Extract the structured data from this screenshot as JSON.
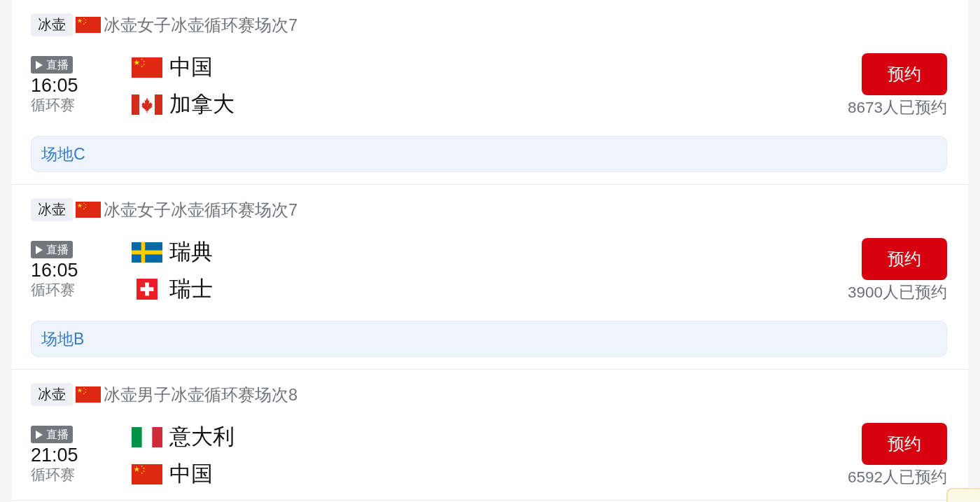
{
  "matches": [
    {
      "sport_tag": "冰壶",
      "event_flag": {
        "kind": "china"
      },
      "event_title": "冰壶女子冰壶循环赛场次7",
      "live_label": "直播",
      "time": "16:05",
      "stage": "循环赛",
      "teams": [
        {
          "kind": "china",
          "name": "中国"
        },
        {
          "kind": "canada",
          "name": "加拿大"
        }
      ],
      "button": "预约",
      "reservations": "8673人已预约",
      "venue": "场地C"
    },
    {
      "sport_tag": "冰壶",
      "event_flag": {
        "kind": "china"
      },
      "event_title": "冰壶女子冰壶循环赛场次7",
      "live_label": "直播",
      "time": "16:05",
      "stage": "循环赛",
      "teams": [
        {
          "kind": "sweden",
          "name": "瑞典"
        },
        {
          "kind": "switzerland",
          "name": "瑞士"
        }
      ],
      "button": "预约",
      "reservations": "3900人已预约",
      "venue": "场地B"
    },
    {
      "sport_tag": "冰壶",
      "event_flag": {
        "kind": "china"
      },
      "event_title": "冰壶男子冰壶循环赛场次8",
      "live_label": "直播",
      "time": "21:05",
      "stage": "循环赛",
      "teams": [
        {
          "kind": "italy",
          "name": "意大利"
        },
        {
          "kind": "china",
          "name": "中国"
        }
      ],
      "button": "预约",
      "reservations": "6592人已预约"
    }
  ]
}
